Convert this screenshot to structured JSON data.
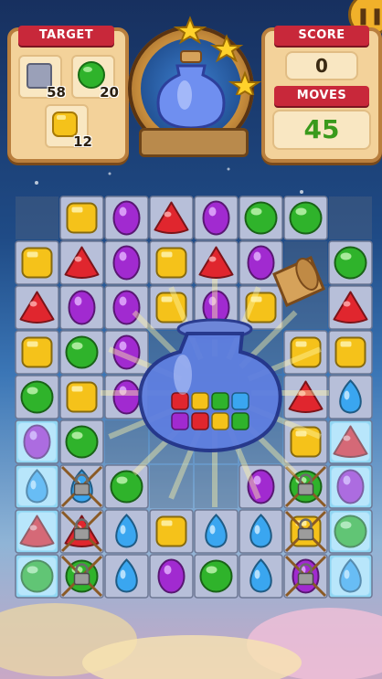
{
  "hud": {
    "target_label": "TARGET",
    "score_label": "SCORE",
    "score_value": "0",
    "moves_label": "MOVES",
    "moves_value": "45",
    "pause_icon": "pause-icon",
    "stars_earned": 3,
    "targets": [
      {
        "item": "ice-block",
        "count": "58"
      },
      {
        "item": "green-candy",
        "count": "20"
      },
      {
        "item": "yellow-candy",
        "count": "12"
      }
    ]
  },
  "colors": {
    "red": "#e0262e",
    "purple": "#a12ad0",
    "yellow": "#f5c21a",
    "green": "#2fb32b",
    "blue": "#3aa6f0",
    "ice": "#8fd6f3",
    "ribbon": "#c8283a"
  },
  "board": {
    "rows": [
      [
        "",
        "yellow",
        "purple",
        "red",
        "purple",
        "green",
        "green",
        ""
      ],
      [
        "yellow",
        "red",
        "purple",
        "yellow",
        "red",
        "purple",
        "",
        "green"
      ],
      [
        "red",
        "purple",
        "purple",
        "yellow",
        "purple",
        "yellow",
        "",
        "red"
      ],
      [
        "yellow",
        "green",
        "purple",
        "",
        "",
        "",
        "yellow",
        "yellow"
      ],
      [
        "green",
        "yellow",
        "purple",
        "",
        "",
        "",
        "red",
        "blue"
      ],
      [
        "ice:purple",
        "green",
        "",
        "",
        "",
        "",
        "yellow",
        "ice:red"
      ],
      [
        "ice:blue",
        "lock:blue",
        "green",
        "",
        "",
        "purple",
        "lock:green",
        "ice:purple"
      ],
      [
        "ice:red",
        "lock:red",
        "blue",
        "yellow",
        "blue",
        "blue",
        "lock:yellow",
        "ice:green"
      ],
      [
        "ice:green",
        "lock:green",
        "blue",
        "purple",
        "green",
        "blue",
        "lock:purple",
        "ice:blue"
      ]
    ]
  },
  "center_item": "potion-bottle-icon",
  "booster": "potion-bottle-icon"
}
